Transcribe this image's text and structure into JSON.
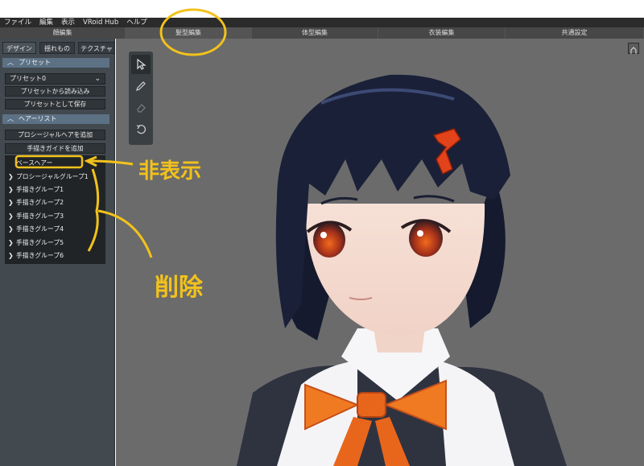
{
  "menu": [
    "ファイル",
    "編集",
    "表示",
    "VRoid Hub",
    "ヘルプ"
  ],
  "tabs": [
    {
      "label": "顔編集",
      "active": false
    },
    {
      "label": "髪型編集",
      "active": true
    },
    {
      "label": "体型編集",
      "active": false
    },
    {
      "label": "衣装編集",
      "active": false
    },
    {
      "label": "共通設定",
      "active": false
    }
  ],
  "subtabs": [
    {
      "label": "デザイン",
      "active": true
    },
    {
      "label": "揺れもの",
      "active": false
    },
    {
      "label": "テクスチャ",
      "active": false
    }
  ],
  "preset_section": {
    "title": "プリセット",
    "selected": "プリセット0",
    "load_button": "プリセットから読み込み",
    "save_button": "プリセットとして保存"
  },
  "hairlist_section": {
    "title": "ヘアーリスト",
    "add_procedural": "プロシージャルヘアを追加",
    "add_guide": "手描きガイドを追加",
    "items": [
      "ベースヘアー",
      "プロシージャルグループ1",
      "手描きグループ1",
      "手描きグループ2",
      "手描きグループ3",
      "手描きグループ4",
      "手描きグループ5",
      "手描きグループ6"
    ]
  },
  "annotations": {
    "hide": "非表示",
    "delete": "削除",
    "color": "#f2c21c"
  },
  "icons": {
    "tool_select": "cursor-arrow-icon",
    "tool_draw": "pencil-icon",
    "tool_erase": "eraser-icon",
    "tool_rotate": "rotate-icon"
  },
  "colors": {
    "viewport_bg": "#6b6b6b",
    "section_head": "#5c7184",
    "sidebar_bg": "#42494f"
  }
}
